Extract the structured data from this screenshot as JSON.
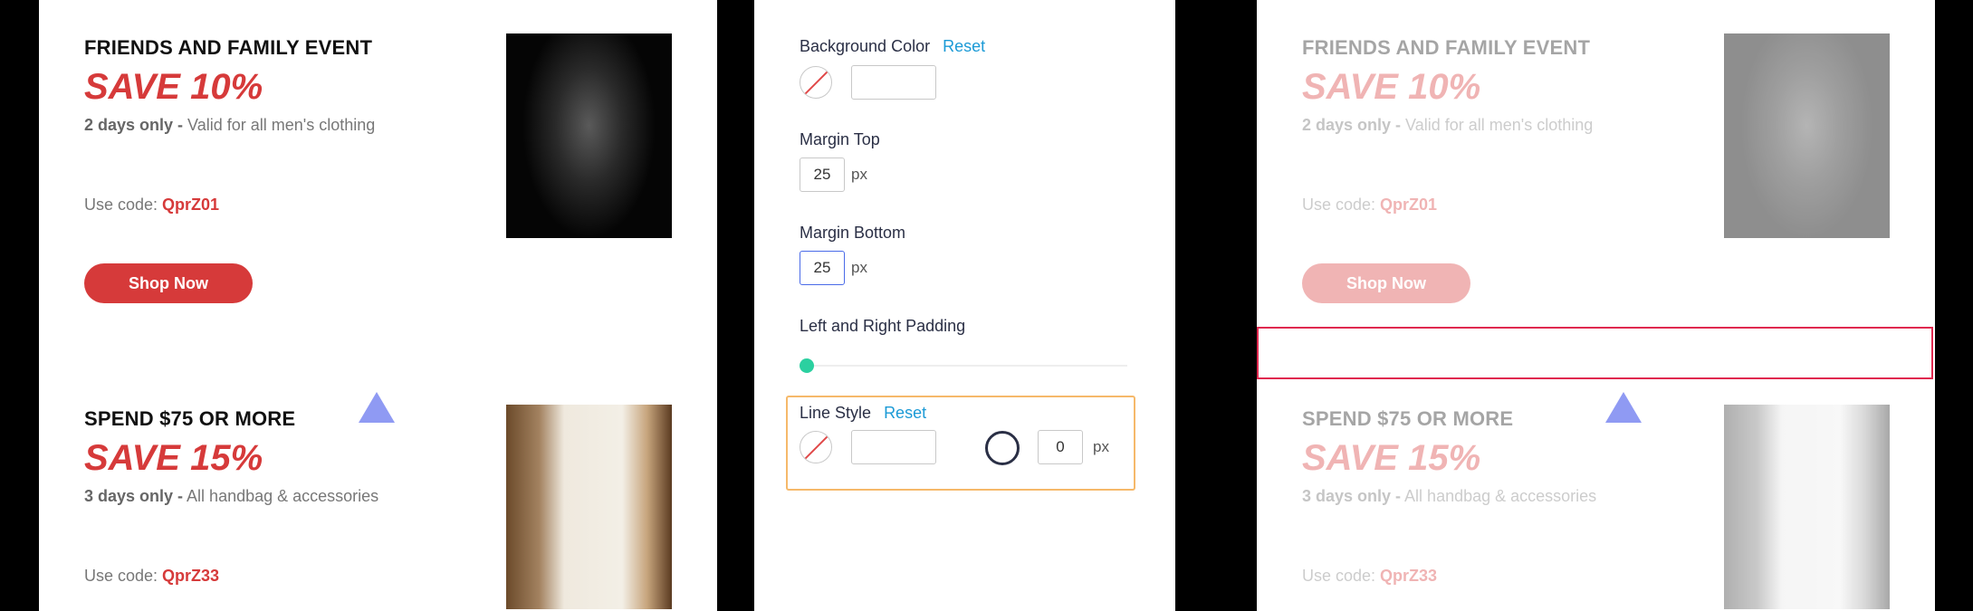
{
  "promos": [
    {
      "title": "FRIENDS AND FAMILY EVENT",
      "save": "SAVE 10%",
      "days_bold": "2 days only -",
      "days_rest": " Valid for all men's clothing",
      "code_label": "Use code: ",
      "code": "QprZ01"
    },
    {
      "title": "SPEND $75 OR MORE",
      "save": "SAVE 15%",
      "days_bold": "3 days only -",
      "days_rest": " All handbag & accessories",
      "code_label": "Use code: ",
      "code": "QprZ33"
    }
  ],
  "shop_label": "Shop Now",
  "settings": {
    "bg_color_label": "Background Color",
    "reset": "Reset",
    "margin_top_label": "Margin Top",
    "margin_top": "25",
    "margin_bottom_label": "Margin Bottom",
    "margin_bottom": "25",
    "unit": "px",
    "padding_label": "Left and Right Padding",
    "padding_value": 0,
    "line_style_label": "Line Style",
    "line_width": "0"
  },
  "colors": {
    "accent": "#d63a3a",
    "link": "#1b9ad6",
    "highlight": "#f6b96a",
    "selection": "#e0294f",
    "slider": "#2bd0a0"
  }
}
